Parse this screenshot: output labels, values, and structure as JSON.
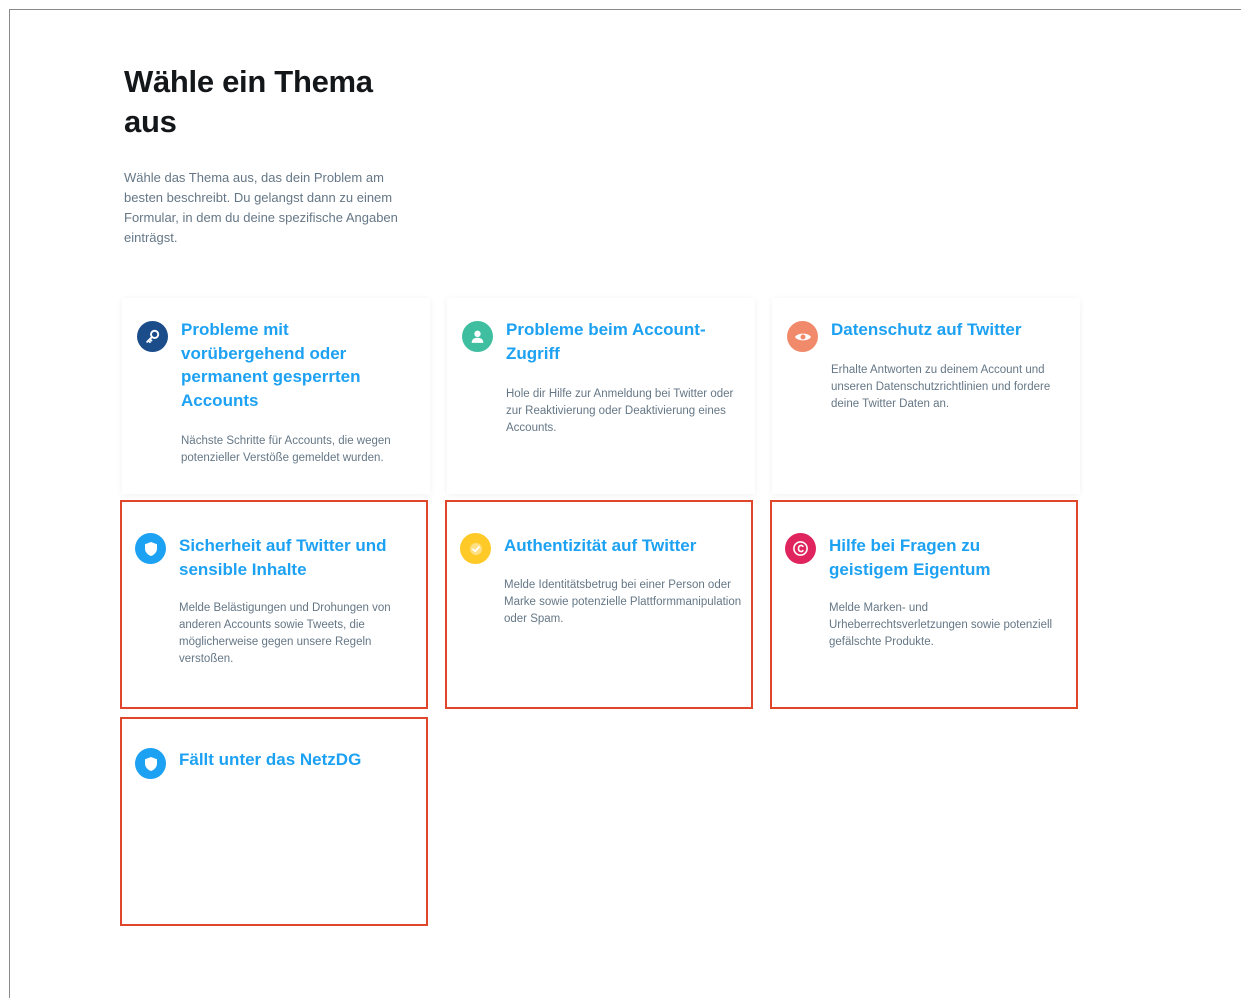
{
  "header": {
    "title": "Wähle ein Thema aus",
    "intro": "Wähle das Thema aus, das dein Problem am besten beschreibt. Du gelangst dann zu einem Formular, in dem du deine spezifische Angaben einträgst."
  },
  "cards": [
    {
      "title": "Probleme mit vorübergehend oder permanent gesperrten Accounts",
      "desc": "Nächste Schritte für Accounts, die wegen potenzieller Verstöße gemeldet wurden.",
      "icon": "key-icon",
      "color": "#1b4d8a"
    },
    {
      "title": "Probleme beim Account-Zugriff",
      "desc": "Hole dir Hilfe zur Anmeldung bei Twitter oder zur Reaktivierung oder Deaktivierung eines Accounts.",
      "icon": "user-icon",
      "color": "#3fbfa0"
    },
    {
      "title": "Datenschutz auf Twitter",
      "desc": "Erhalte Antworten zu deinem Account und unseren Datenschutzrichtlinien und fordere deine Twitter Daten an.",
      "icon": "eye-icon",
      "color": "#f08a6a"
    },
    {
      "title": "Sicherheit auf Twitter und sensible Inhalte",
      "desc": "Melde Belästigungen und Drohungen von anderen Accounts sowie Tweets, die möglicherweise gegen unsere Regeln verstoßen.",
      "icon": "shield-icon",
      "color": "#1da1f2"
    },
    {
      "title": "Authentizität auf Twitter",
      "desc": "Melde Identitätsbetrug bei einer Person oder Marke sowie potenzielle Plattformmanipulation oder Spam.",
      "icon": "check-badge-icon",
      "color": "#ffc928"
    },
    {
      "title": "Hilfe bei Fragen zu geistigem Eigentum",
      "desc": "Melde Marken- und Urheberrechtsverletzungen sowie potenziell gefälschte Produkte.",
      "icon": "copyright-icon",
      "color": "#e0245e"
    },
    {
      "title": "Fällt unter das NetzDG",
      "desc": "",
      "icon": "shield-icon",
      "color": "#1da1f2"
    }
  ]
}
